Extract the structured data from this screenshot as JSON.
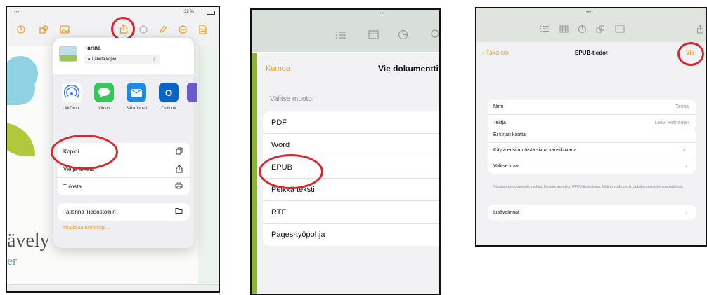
{
  "colors": {
    "accent": "#f0a01e",
    "highlight": "#d9272e",
    "airdrop": "#3478f6",
    "messages": "#34c759",
    "mail": "#1e88e5",
    "outlook": "#0a64c8"
  },
  "panel1": {
    "status": {
      "dots": "•••",
      "battery": "32 %"
    },
    "toolbar_icons": [
      "clock-icon",
      "shapes-icon",
      "media-icon",
      "share-icon",
      "comment-icon",
      "pen-icon",
      "minus-icon",
      "document-icon"
    ],
    "doc_word": "ävely",
    "doc_word2": "er",
    "popover": {
      "doc_title": "Tarina",
      "send_copy": "Lähetä kopio",
      "apps": [
        {
          "label": "AirDrop",
          "icon": "airdrop-icon"
        },
        {
          "label": "Viestit",
          "icon": "messages-icon"
        },
        {
          "label": "Sähköposti",
          "icon": "mail-icon"
        },
        {
          "label": "Outlook",
          "icon": "outlook-icon"
        }
      ],
      "actions": [
        {
          "label": "Kopioi",
          "icon": "copy-icon"
        },
        {
          "label": "Vie ja lähetä",
          "icon": "share-icon"
        },
        {
          "label": "Tulosta",
          "icon": "printer-icon"
        }
      ],
      "save_files": "Tallenna Tiedostoihin",
      "edit_actions": "Muokkaa toimintoja..."
    }
  },
  "panel2": {
    "status_dots": "•••",
    "cancel": "Kumoa",
    "title": "Vie dokumentti",
    "section_label": "Valitse muoto.",
    "formats": [
      "PDF",
      "Word",
      "EPUB",
      "Pelkkä teksti",
      "RTF",
      "Pages-työpohja"
    ]
  },
  "panel3": {
    "status_dots": "•••",
    "back": "Takaisin",
    "title": "EPUB-tiedot",
    "export": "Vie",
    "name_label": "Nimi",
    "name_value": "Tarina",
    "author_label": "Tekijä",
    "author_value": "Leevi Heinänen",
    "cover_options": [
      "Ei kirjan kantta",
      "Käytä ensimmäistä sivua kansikuvana",
      "Valitse kuva"
    ],
    "note": "Sivuasetteludokumentit viedään kiinteän asettelun EPUB-tiedostoina. Niitä ei voida viedä uudelleenasettelevana sisältönä.",
    "more_options": "Lisävalinnat"
  }
}
